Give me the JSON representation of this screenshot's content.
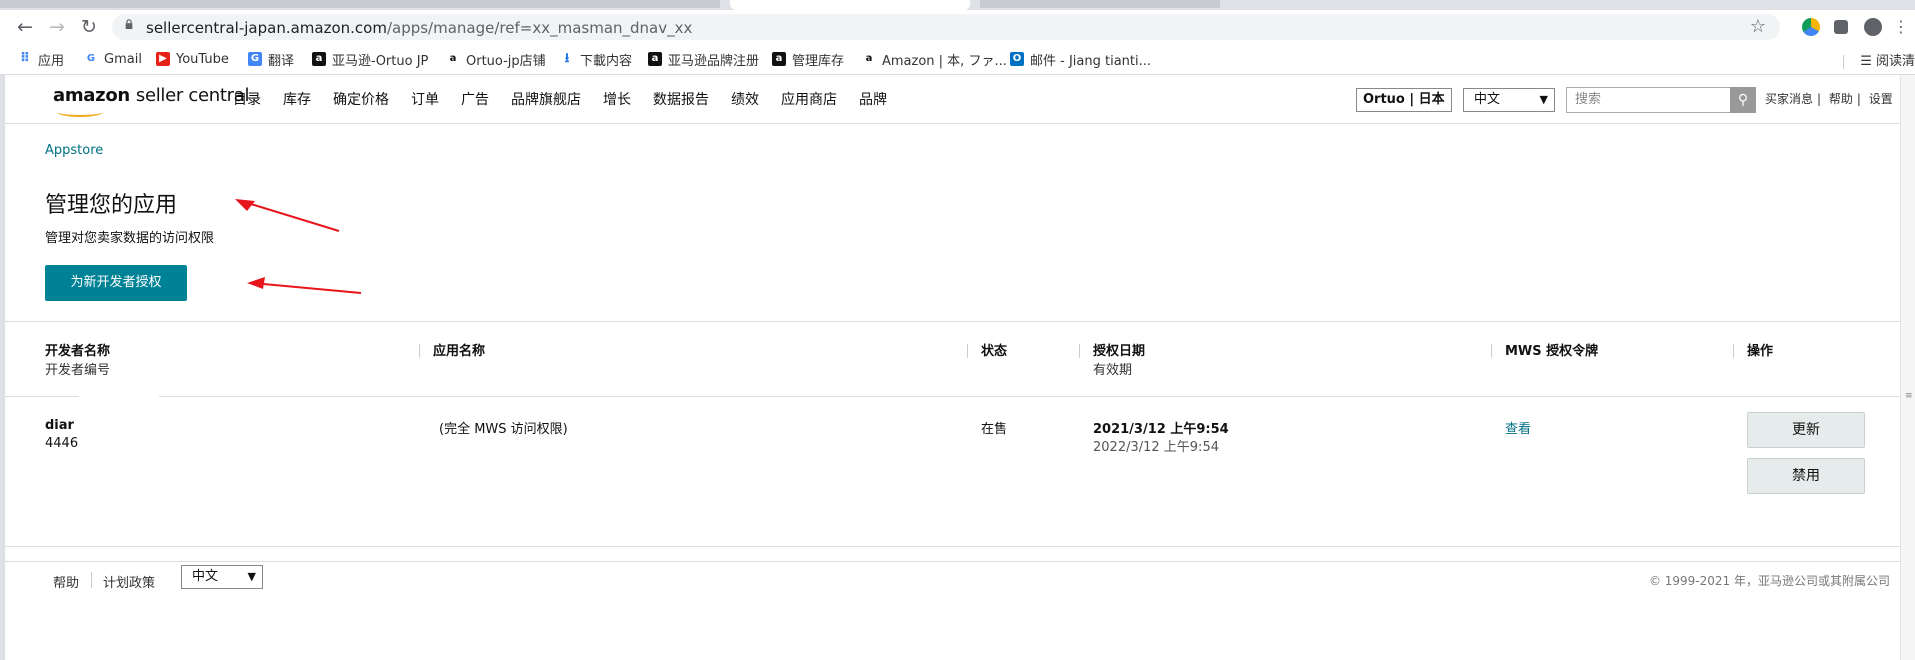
{
  "browser": {
    "url_host": "sellercentral-japan.amazon.com",
    "url_path": "/apps/manage/ref=xx_masman_dnav_xx"
  },
  "bookmarks": {
    "items": [
      {
        "label": "应用",
        "icon": "apps-grid-icon"
      },
      {
        "label": "Gmail",
        "icon": "google-icon"
      },
      {
        "label": "YouTube",
        "icon": "youtube-icon"
      },
      {
        "label": "翻译",
        "icon": "translate-icon"
      },
      {
        "label": "亚马逊-Ortuo JP",
        "icon": "amazon-a-icon"
      },
      {
        "label": "Ortuo-jp店铺",
        "icon": "amazon-icon"
      },
      {
        "label": "下載内容",
        "icon": "download-icon"
      },
      {
        "label": "亚马逊品牌注册",
        "icon": "amazon-a-icon"
      },
      {
        "label": "管理库存",
        "icon": "amazon-a-icon"
      },
      {
        "label": "Amazon | 本, ファ...",
        "icon": "amazon-icon"
      },
      {
        "label": "邮件 - Jiang tianti...",
        "icon": "outlook-icon"
      }
    ],
    "reading_list": "阅读清"
  },
  "seller": {
    "logo_brand": "amazon",
    "logo_product": "seller central",
    "nav": [
      "目录",
      "库存",
      "确定价格",
      "订单",
      "广告",
      "品牌旗舰店",
      "增长",
      "数据报告",
      "绩效",
      "应用商店",
      "品牌"
    ],
    "store": "Ortuo | 日本",
    "language": "中文",
    "search_placeholder": "搜索",
    "toplinks": [
      "买家消息",
      "帮助",
      "设置"
    ]
  },
  "content": {
    "breadcrumb": "Appstore",
    "title": "管理您的应用",
    "subtitle": "管理对您卖家数据的访问权限",
    "grant_button": "为新开发者授权"
  },
  "table": {
    "headers": {
      "developer_name": "开发者名称",
      "developer_id": "开发者编号",
      "app_name": "应用名称",
      "status": "状态",
      "auth_date": "授权日期",
      "expiry": "有效期",
      "mws_token": "MWS 授权令牌",
      "actions": "操作"
    },
    "rows": [
      {
        "developer_name": "diar",
        "developer_id": "4446",
        "app_name": "(完全 MWS 访问权限)",
        "status": "在售",
        "auth_date": "2021/3/12 上午9:54",
        "expiry": "2022/3/12 上午9:54",
        "mws_token": "查看",
        "renew": "更新",
        "disable": "禁用"
      }
    ]
  },
  "footer": {
    "help": "帮助",
    "program_policy": "计划政策",
    "language": "中文",
    "copyright": "© 1999-2021 年，亚马逊公司或其附属公司"
  },
  "colors": {
    "teal": "#008296",
    "link": "#007185",
    "annotation_arrow": "#e8141b"
  }
}
